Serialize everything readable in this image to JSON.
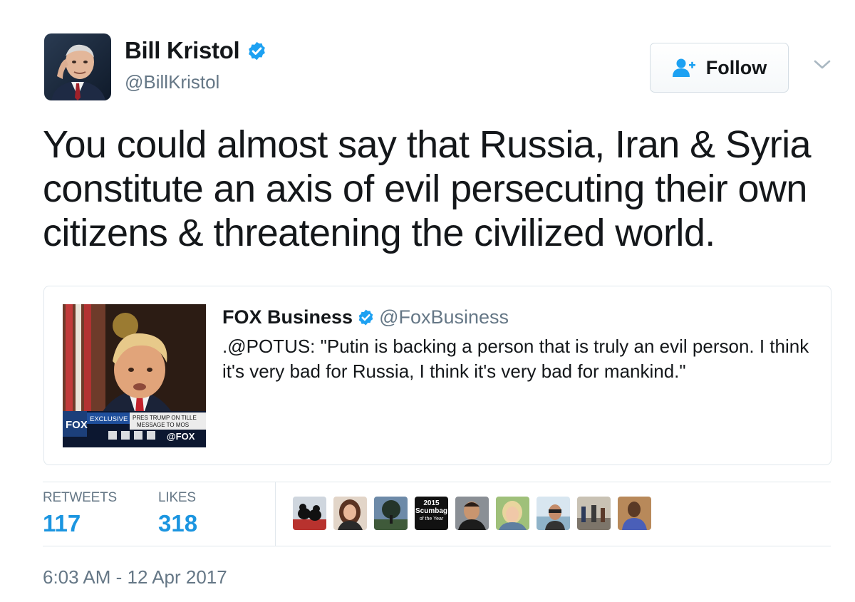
{
  "author": {
    "name": "Bill Kristol",
    "handle": "@BillKristol",
    "verified": true
  },
  "follow_button": {
    "label": "Follow",
    "icon": "add-user-icon"
  },
  "menu_icon": "chevron-down-icon",
  "tweet_text": "You could almost say that Russia, Iran & Syria constitute an axis of evil persecuting their own citizens & threatening the civilized world.",
  "quoted_tweet": {
    "name": "FOX Business",
    "handle": "@FoxBusiness",
    "verified": true,
    "text": ".@POTUS: \"Putin is backing a person that is truly an evil person. I think it's very bad for Russia, I think it's very bad for mankind.\"",
    "media": {
      "chyron_tag": "EXCLUSIVE",
      "chyron_line1": "PRES TRUMP ON TILLE",
      "chyron_line2": "MESSAGE TO MOS",
      "network": "FOX",
      "social_handle": "@FOX"
    }
  },
  "stats": {
    "retweets_label": "RETWEETS",
    "retweets_value": "117",
    "likes_label": "LIKES",
    "likes_value": "318"
  },
  "likers_badge": {
    "year": "2015",
    "line1": "Scumbag",
    "line2": "of the Year"
  },
  "timestamp": "6:03 AM - 12 Apr 2017",
  "colors": {
    "accent": "#1b95e0",
    "verified": "#1da1f2",
    "secondary_text": "#657786",
    "border": "#e1e8ed"
  }
}
